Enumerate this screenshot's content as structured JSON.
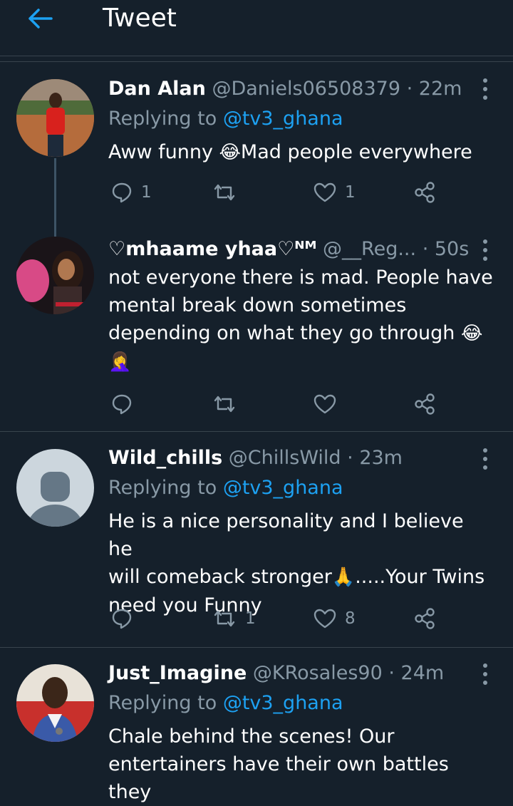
{
  "header": {
    "title": "Tweet"
  },
  "tweets": [
    {
      "name": "Dan Alan",
      "handle": "@Daniels06508379",
      "time": "· 22m",
      "replying_prefix": "Replying to ",
      "replying_handle": "@tv3_ghana",
      "text_before": "Aww funny ",
      "emoji": "😂",
      "text_after": "Mad people everywhere",
      "reply_count": "1",
      "retweet_count": "",
      "like_count": "1"
    },
    {
      "name": "♡mhaame yhaa♡ᴺᴹ",
      "handle": "@__Reg...",
      "time": "· 50s",
      "text_line1": "not everyone there is mad. People have",
      "text_line2": "mental break down sometimes",
      "text_line3": "depending on what they go through ",
      "emoji1": "😂",
      "emoji2": "🤦‍♀️",
      "reply_count": "",
      "retweet_count": "",
      "like_count": ""
    },
    {
      "name": "Wild_chills",
      "handle": "@ChillsWild",
      "time": "· 23m",
      "replying_prefix": "Replying to ",
      "replying_handle": "@tv3_ghana",
      "text_line1": "He is a nice personality and I believe he",
      "text_line2_before": "will comeback stronger",
      "emoji": "🙏",
      "text_line2_after": ".....Your Twins",
      "text_line3": "need you Funny",
      "reply_count": "",
      "retweet_count": "1",
      "like_count": "8"
    },
    {
      "name": "Just_Imagine",
      "handle": "@KRosales90",
      "time": "· 24m",
      "replying_prefix": "Replying to ",
      "replying_handle": "@tv3_ghana",
      "text_line1": "Chale behind the scenes! Our",
      "text_line2": "entertainers have their own battles they"
    }
  ],
  "colors": {
    "background": "#15202b",
    "accent": "#1da1f2",
    "secondary_text": "#8899a6",
    "divider": "#38444d"
  },
  "icons": [
    "back-arrow-icon",
    "reply-icon",
    "retweet-icon",
    "like-icon",
    "share-icon",
    "more-icon"
  ]
}
